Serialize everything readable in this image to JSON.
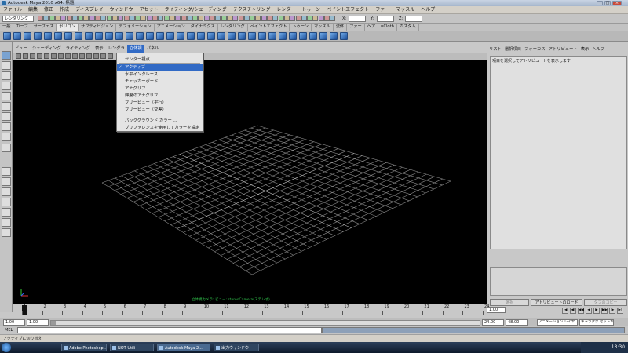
{
  "window": {
    "title": "Autodesk Maya 2010 x64: 無題",
    "min": "_",
    "max": "□",
    "close": "×"
  },
  "menubar": [
    "ファイル",
    "編集",
    "修正",
    "作成",
    "ディスプレイ",
    "ウィンドウ",
    "アセット",
    "ライティング/シェーディング",
    "テクスチャリング",
    "レンダー",
    "トゥーン",
    "ペイントエフェクト",
    "ファー",
    "マッスル",
    "ヘルプ"
  ],
  "statusline": {
    "mode": "レンダリング",
    "x_label": "X:",
    "y_label": "Y:",
    "z_label": "Z:"
  },
  "shelf_tabs": [
    "一般",
    "カーブ",
    "サーフェス",
    "ポリゴン",
    "サブディビジョン",
    "デフォメーション",
    "アニメーション",
    "ダイナミクス",
    "レンダリング",
    "ペイントエフェクト",
    "トゥーン",
    "マッスル",
    "流体",
    "ファー",
    "ヘア",
    "nCloth",
    "カスタム"
  ],
  "shelf_active_index": 3,
  "panel_menu": [
    "ビュー",
    "シェーディング",
    "ライティング",
    "表示",
    "レンダラ",
    "立体視",
    "パネル"
  ],
  "panel_menu_active_index": 5,
  "dropdown": {
    "items": [
      {
        "label": "センター視点",
        "checked": false,
        "highlighted": false
      },
      {
        "label": "アクティブ",
        "checked": true,
        "highlighted": true
      },
      {
        "label": "水平インタレース",
        "checked": false,
        "highlighted": false
      },
      {
        "label": "チェッカーボード",
        "checked": false,
        "highlighted": false
      },
      {
        "label": "アナグリフ",
        "checked": false,
        "highlighted": false
      },
      {
        "label": "輝度のアナグリフ",
        "checked": false,
        "highlighted": false
      },
      {
        "label": "フリービュー（平行）",
        "checked": false,
        "highlighted": false
      },
      {
        "label": "フリービュー（交差）",
        "checked": false,
        "highlighted": false
      },
      {
        "label": "バックグラウンド カラー ...",
        "checked": false,
        "highlighted": false
      },
      {
        "label": "プリファレンスを使用してカラーを設定",
        "checked": false,
        "highlighted": false
      }
    ],
    "check_glyph": "✓"
  },
  "viewport": {
    "caption": "立体視カメラ: ビュー: stereoCamera(ステレオ)"
  },
  "attribute_editor": {
    "menu": [
      "リスト",
      "選択項目",
      "フォーカス",
      "アトリビュート",
      "表示",
      "ヘルプ"
    ],
    "hint": "項目を選択してアトリビュートを表示します",
    "select_button": "選択",
    "load_button": "アトリビュートのロード",
    "copy_button": "タブのコピー"
  },
  "timeline": {
    "ticks": [
      "1",
      "2",
      "3",
      "4",
      "5",
      "6",
      "7",
      "8",
      "9",
      "10",
      "11",
      "12",
      "13",
      "14",
      "15",
      "16",
      "17",
      "18",
      "19",
      "20",
      "21",
      "22",
      "23",
      "24"
    ],
    "current_frame": "1.00"
  },
  "playback": {
    "buttons": [
      "|◀",
      "◀|",
      "◀◀",
      "◀",
      "▶",
      "▶▶",
      "|▶",
      "▶|"
    ]
  },
  "range": {
    "start": "1.00",
    "start_inner": "1.00",
    "end_inner": "24.00",
    "end": "48.00",
    "anim_layer": "アニメーション レイヤ",
    "character": "キャラクタ セットなし"
  },
  "command": {
    "label": "MEL"
  },
  "helpline": {
    "text": "アクティブに切り替え"
  },
  "taskbar": {
    "items": [
      "Adobe Photoshop ...",
      "NOT Utili",
      "Autodesk Maya 2...",
      "出力ウィンドウ"
    ],
    "active_index": 2,
    "clock": "13:30"
  }
}
